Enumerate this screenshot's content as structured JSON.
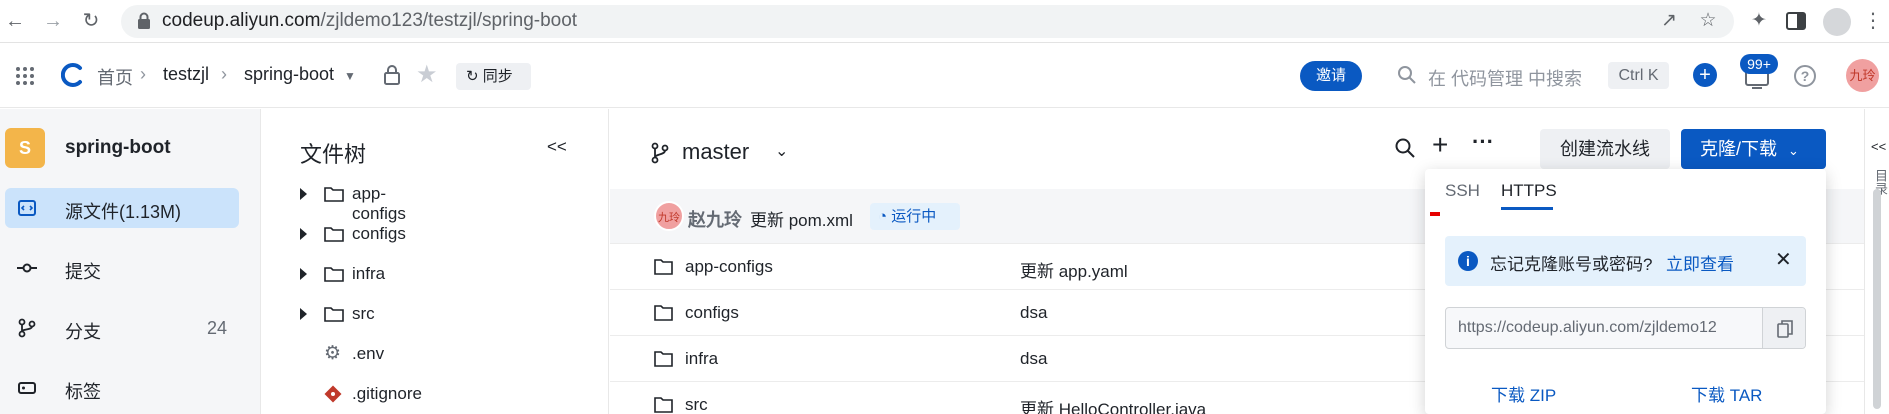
{
  "browser": {
    "url_host": "codeup.aliyun.com",
    "url_path": "/zjldemo123/testzjl/spring-boot",
    "icons": [
      "back-icon",
      "forward-icon",
      "reload-icon",
      "lock-icon",
      "share-icon",
      "star-icon",
      "extensions-icon",
      "sidepanel-icon",
      "profile-icon",
      "menu-icon"
    ]
  },
  "header": {
    "breadcrumb": {
      "home": "首页",
      "group": "testzjl",
      "repo": "spring-boot"
    },
    "sync_label": "同步",
    "invite_label": "邀请",
    "search_placeholder": "在 代码管理 中搜索",
    "shortcut": "Ctrl K",
    "notify_badge": "99+",
    "avatar_text": "九玲"
  },
  "sidebar": {
    "repo_initial": "S",
    "repo_name": "spring-boot",
    "items": [
      {
        "label": "源文件(1.13M)",
        "count": ""
      },
      {
        "label": "提交",
        "count": ""
      },
      {
        "label": "分支",
        "count": "24"
      },
      {
        "label": "标签",
        "count": ""
      }
    ]
  },
  "tree": {
    "title": "文件树",
    "items": [
      {
        "label": "app-configs",
        "type": "folder"
      },
      {
        "label": "configs",
        "type": "folder"
      },
      {
        "label": "infra",
        "type": "folder"
      },
      {
        "label": "src",
        "type": "folder"
      },
      {
        "label": ".env",
        "type": "config"
      },
      {
        "label": ".gitignore",
        "type": "git"
      }
    ]
  },
  "main": {
    "branch": "master",
    "create_pipeline": "创建流水线",
    "clone_download": "克隆/下载",
    "commit": {
      "avatar_text": "九玲",
      "author": "赵九玲",
      "message": "更新 pom.xml",
      "status": "运行中"
    },
    "files": [
      {
        "name": "app-configs",
        "message": "更新 app.yaml"
      },
      {
        "name": "configs",
        "message": "dsa"
      },
      {
        "name": "infra",
        "message": "dsa"
      },
      {
        "name": "src",
        "message": "更新 HelloController.java"
      }
    ]
  },
  "clone": {
    "tabs": [
      "SSH",
      "HTTPS"
    ],
    "active_tab": "HTTPS",
    "info_text": "忘记克隆账号或密码?",
    "info_link": "立即查看",
    "url": "https://codeup.aliyun.com/zjldemo12",
    "download_zip": "下载 ZIP",
    "download_tar": "下载 TAR"
  },
  "right_rail_text": "目录",
  "colors": {
    "brand": "#0a59c2",
    "active_bg": "#cbe3fb",
    "repo_avatar": "#f3b54a"
  }
}
